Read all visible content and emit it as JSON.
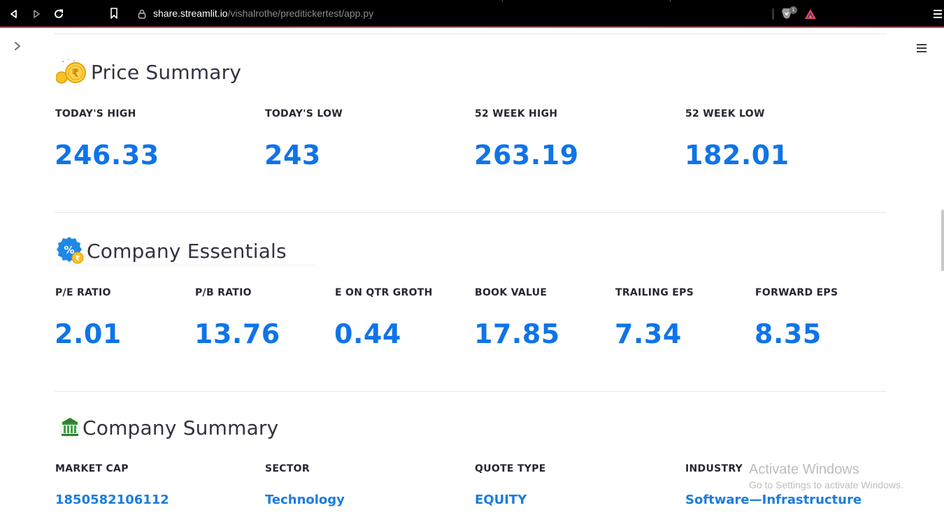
{
  "browser": {
    "url_host": "share.streamlit.io",
    "url_path": "/vishalrothe/preditickertest/app.py",
    "brave_shield_count": "1"
  },
  "price_summary": {
    "title": "Price Summary",
    "metrics": [
      {
        "label": "TODAY'S HIGH",
        "value": "246.33"
      },
      {
        "label": "TODAY'S LOW",
        "value": "243"
      },
      {
        "label": "52 WEEK HIGH",
        "value": "263.19"
      },
      {
        "label": "52 WEEK LOW",
        "value": "182.01"
      }
    ]
  },
  "company_essentials": {
    "title": "Company Essentials",
    "metrics": [
      {
        "label": "P/E RATIO",
        "value": "2.01"
      },
      {
        "label": "P/B RATIO",
        "value": "13.76"
      },
      {
        "label": "E ON QTR GROTH",
        "value": "0.44"
      },
      {
        "label": "BOOK VALUE",
        "value": "17.85"
      },
      {
        "label": "TRAILING EPS",
        "value": "7.34"
      },
      {
        "label": "FORWARD EPS",
        "value": "8.35"
      }
    ]
  },
  "company_summary": {
    "title": "Company Summary",
    "metrics": [
      {
        "label": "MARKET CAP",
        "value": "1850582106112"
      },
      {
        "label": "SECTOR",
        "value": "Technology"
      },
      {
        "label": "QUOTE TYPE",
        "value": "EQUITY"
      },
      {
        "label": "INDUSTRY",
        "value": "Software—Infrastructure"
      }
    ]
  },
  "windows_watermark": {
    "title": "Activate Windows",
    "subtitle": "Go to Settings to activate Windows."
  },
  "colors": {
    "metric_value": "#0f74e8",
    "chrome_bg": "#000000",
    "chrome_accent": "#e8304a"
  }
}
